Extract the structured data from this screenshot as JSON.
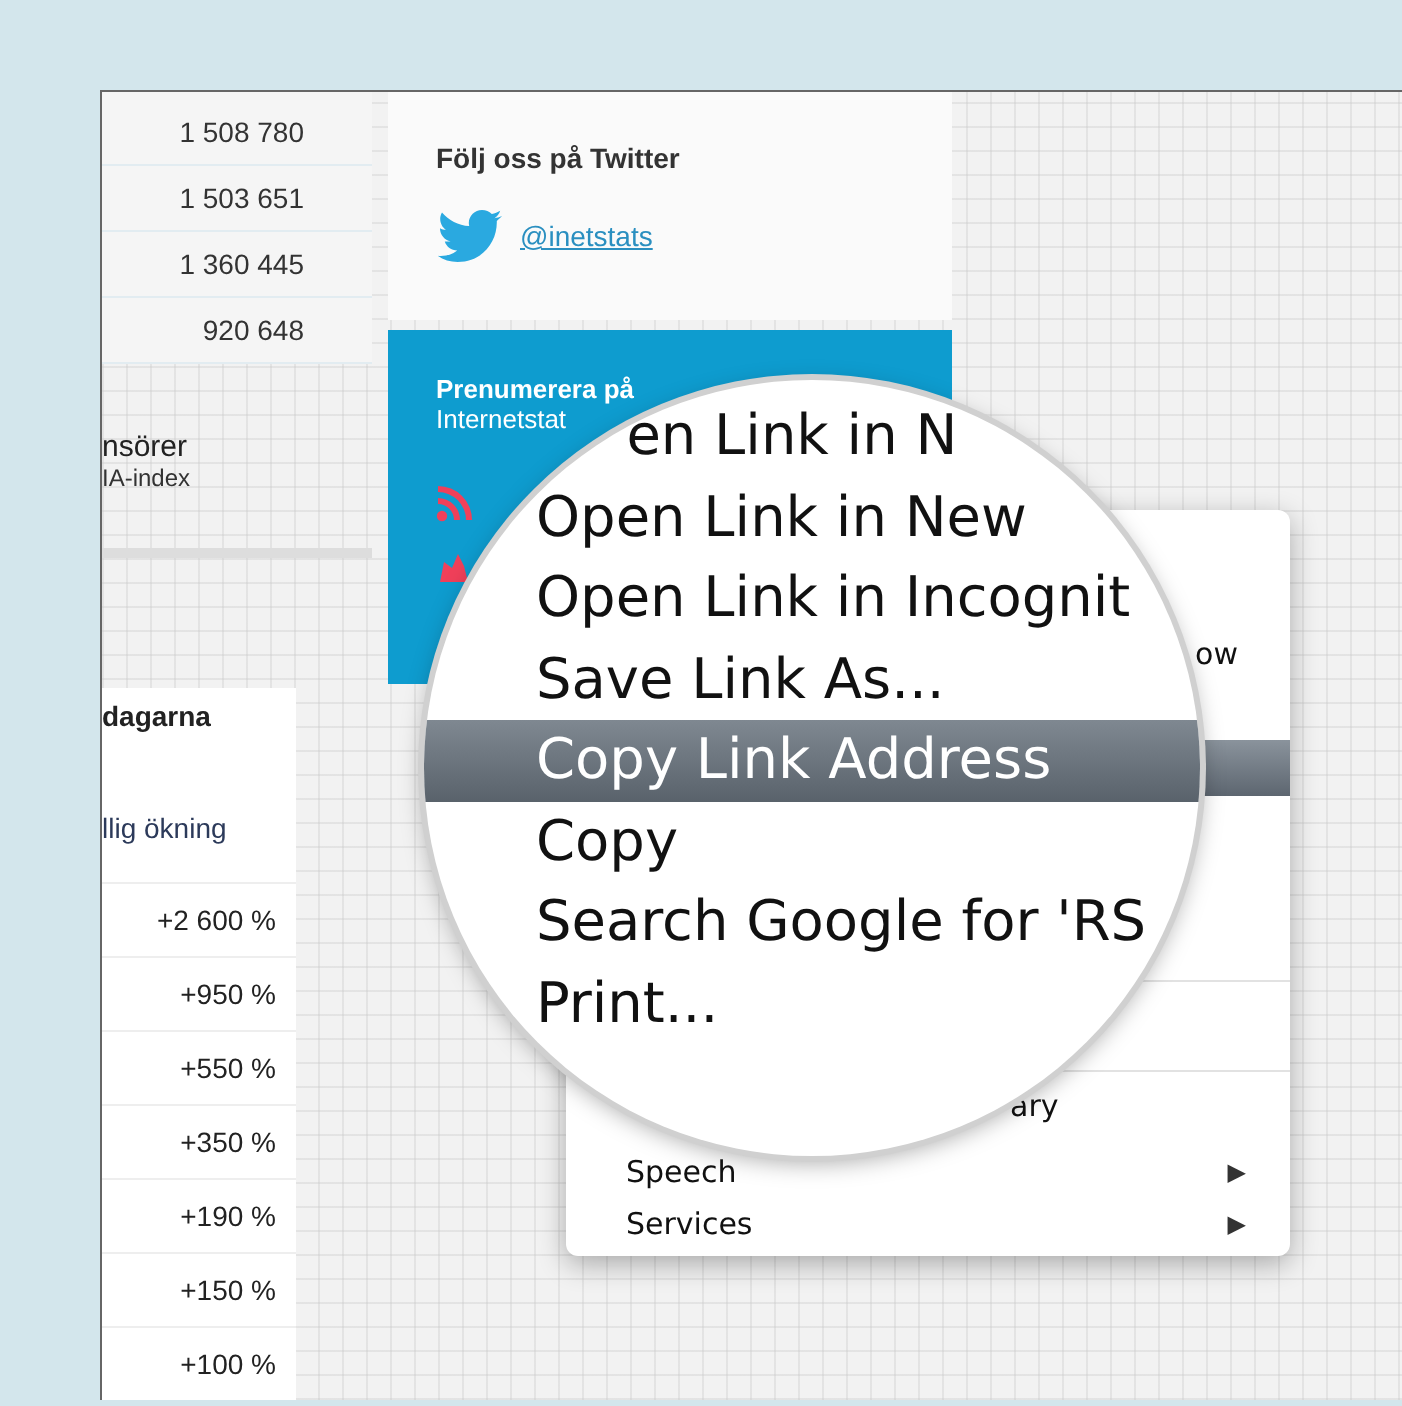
{
  "stats": {
    "values": [
      "1 508 780",
      "1 503 651",
      "1 360 445",
      "920 648"
    ]
  },
  "sponsors": {
    "title": "nsörer",
    "subtitle": "IA-index"
  },
  "table": {
    "header": "dagarna",
    "column": "llig ökning",
    "rows": [
      "+2 600 %",
      "+950 %",
      "+550 %",
      "+350 %",
      "+190 %",
      "+150 %",
      "+100 %"
    ]
  },
  "twitter_card": {
    "title": "Följ oss på Twitter",
    "link": "@inetstats"
  },
  "subscribe_card": {
    "line_1": "Prenumerera på",
    "line_2": "Internetstat"
  },
  "context_menu": {
    "items": [
      {
        "kind": "item",
        "label": "ow"
      },
      {
        "kind": "highlight"
      },
      {
        "kind": "separator"
      },
      {
        "kind": "separator"
      },
      {
        "kind": "item",
        "label": "ary"
      },
      {
        "kind": "submenu",
        "label": "Speech",
        "arrow": "▶"
      },
      {
        "kind": "submenu",
        "label": "Services",
        "arrow": "▶"
      }
    ]
  },
  "magnifier": {
    "items": [
      {
        "label": "en Link in N",
        "selected": false
      },
      {
        "label": "Open Link in New",
        "selected": false
      },
      {
        "label": "Open Link in Incognit",
        "selected": false
      },
      {
        "label": "Save Link As...",
        "selected": false
      },
      {
        "label": "Copy Link Address",
        "selected": true
      },
      {
        "label": "Copy",
        "selected": false
      },
      {
        "label": "Search Google for 'RS",
        "selected": false
      },
      {
        "label": "Print...",
        "selected": false
      }
    ]
  }
}
